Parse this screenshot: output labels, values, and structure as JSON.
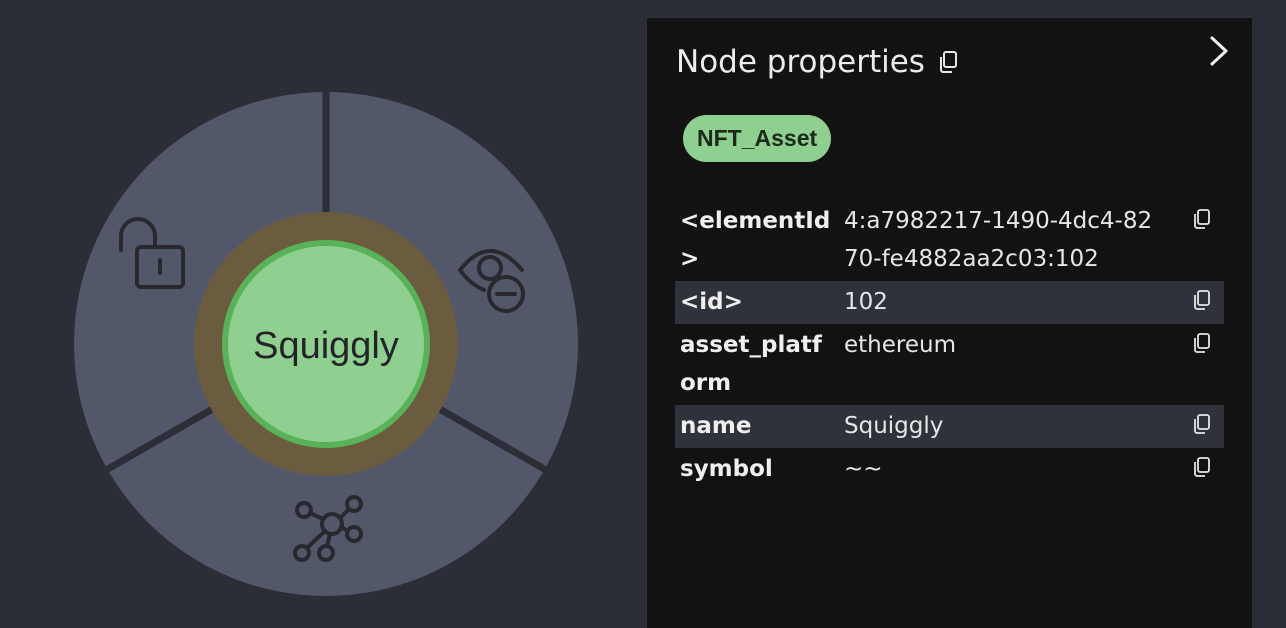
{
  "node": {
    "caption": "Squiggly",
    "colors": {
      "fill": "#8fcf8f",
      "ring": "#59b259",
      "halo": "#6b5c3f",
      "wheel": "#525869",
      "divider": "#2b2e37"
    },
    "actions": [
      {
        "name": "unlock-icon"
      },
      {
        "name": "hide-node-icon"
      },
      {
        "name": "expand-neighbors-icon"
      }
    ]
  },
  "panel": {
    "title": "Node properties",
    "title_copy_icon": "copy-icon",
    "collapse_icon": "chevron-right-icon",
    "label_chip": "NFT_Asset",
    "properties": [
      {
        "key": "<elementId>",
        "value": "4:a7982217-1490-4dc4-8270-fe4882aa2c03:102"
      },
      {
        "key": "<id>",
        "value": "102"
      },
      {
        "key": "asset_platform",
        "value": "ethereum"
      },
      {
        "key": "name",
        "value": "Squiggly"
      },
      {
        "key": "symbol",
        "value": "~~"
      }
    ]
  }
}
